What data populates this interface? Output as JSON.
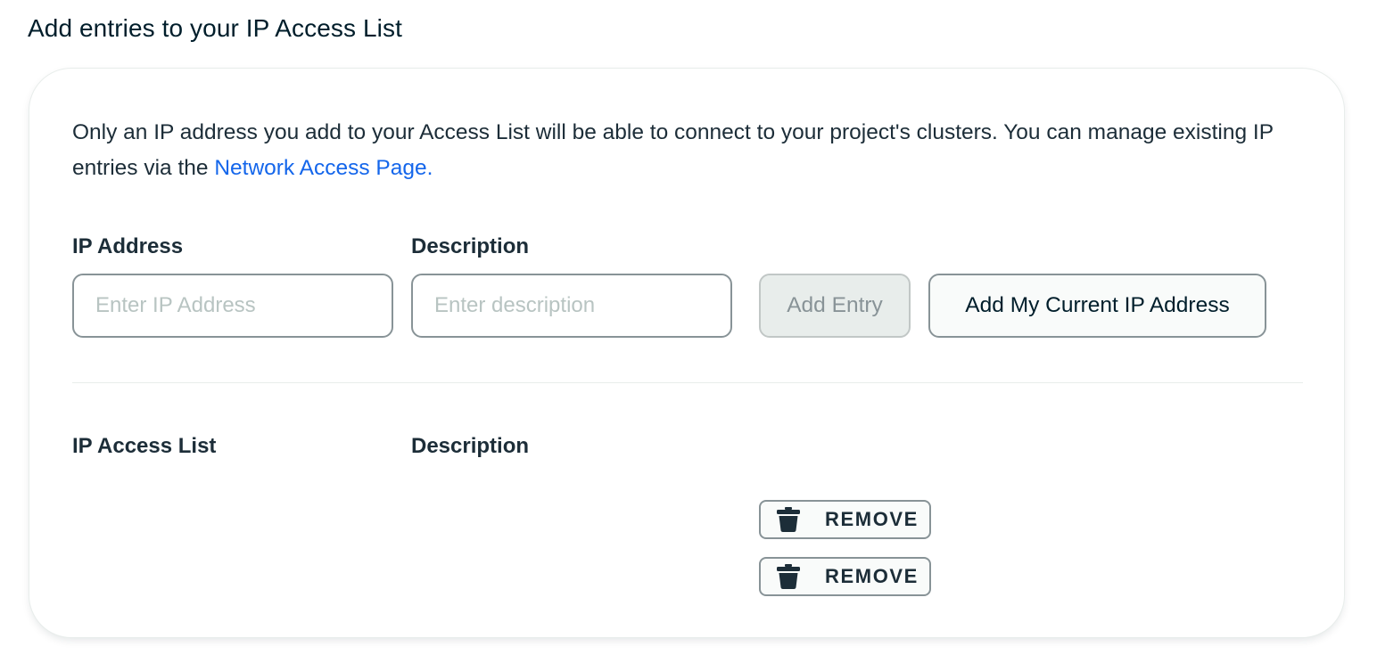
{
  "page": {
    "title": "Add entries to your IP Access List"
  },
  "intro": {
    "text": "Only an IP address you add to your Access List will be able to connect to your project's clusters. You can manage existing IP entries via the ",
    "link_label": "Network Access Page."
  },
  "form": {
    "ip_label": "IP Address",
    "ip_placeholder": "Enter IP Address",
    "ip_value": "",
    "description_label": "Description",
    "description_placeholder": "Enter description",
    "description_value": "",
    "add_entry_label": "Add Entry",
    "add_current_ip_label": "Add My Current IP Address"
  },
  "access_list": {
    "column_ip": "IP Access List",
    "column_description": "Description",
    "rows": [
      {
        "ip": "",
        "description": "",
        "remove_label": "REMOVE",
        "icon": "trash-icon"
      },
      {
        "ip": "",
        "description": "",
        "remove_label": "REMOVE",
        "icon": "trash-icon"
      }
    ]
  },
  "colors": {
    "link": "#1466eb",
    "text": "#1c2d38",
    "border": "#889397",
    "disabled_bg": "#e8edeb"
  }
}
